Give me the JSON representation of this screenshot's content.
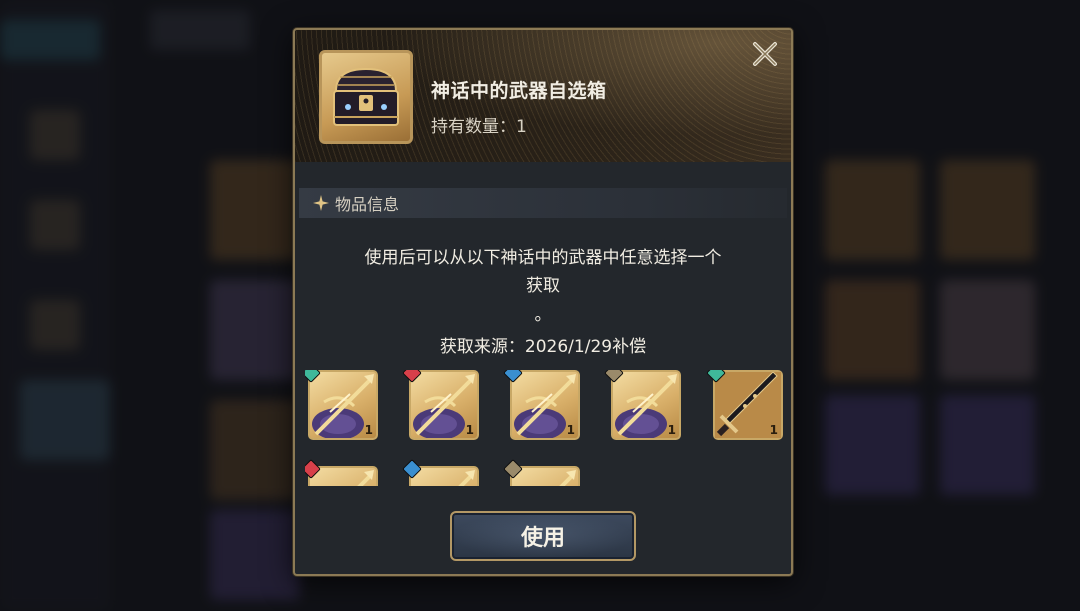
{
  "item": {
    "name": "神话中的武器自选箱",
    "count_label": "持有数量：1",
    "icon": "treasure-chest-icon"
  },
  "close": {
    "icon": "close-x-icon"
  },
  "section": {
    "title": "物品信息",
    "icon": "sparkle-star-icon"
  },
  "description": {
    "line1": "使用后可以从以下神话中的武器中任意选择一个",
    "line2": "获取",
    "line3": "。"
  },
  "source": "获取来源：2026/1/29补偿",
  "weapons": [
    {
      "kind": "spear",
      "badge_color": "#3fb89a",
      "qty": "1"
    },
    {
      "kind": "spear",
      "badge_color": "#d8404a",
      "qty": "1"
    },
    {
      "kind": "spear",
      "badge_color": "#3a8fd0",
      "qty": "1"
    },
    {
      "kind": "spear",
      "badge_color": "#9a8a6a",
      "qty": "1"
    },
    {
      "kind": "sword",
      "badge_color": "#3fb89a",
      "qty": "1"
    },
    {
      "kind": "partial",
      "badge_color": "#d8404a",
      "qty": ""
    },
    {
      "kind": "partial",
      "badge_color": "#3a8fd0",
      "qty": ""
    },
    {
      "kind": "partial",
      "badge_color": "#9a8a6a",
      "qty": ""
    }
  ],
  "use_button": {
    "label": "使用"
  },
  "colors": {
    "frame_gold": "#b8955a",
    "panel_bg": "#23272c",
    "button_blue": "#3d4a5e"
  }
}
